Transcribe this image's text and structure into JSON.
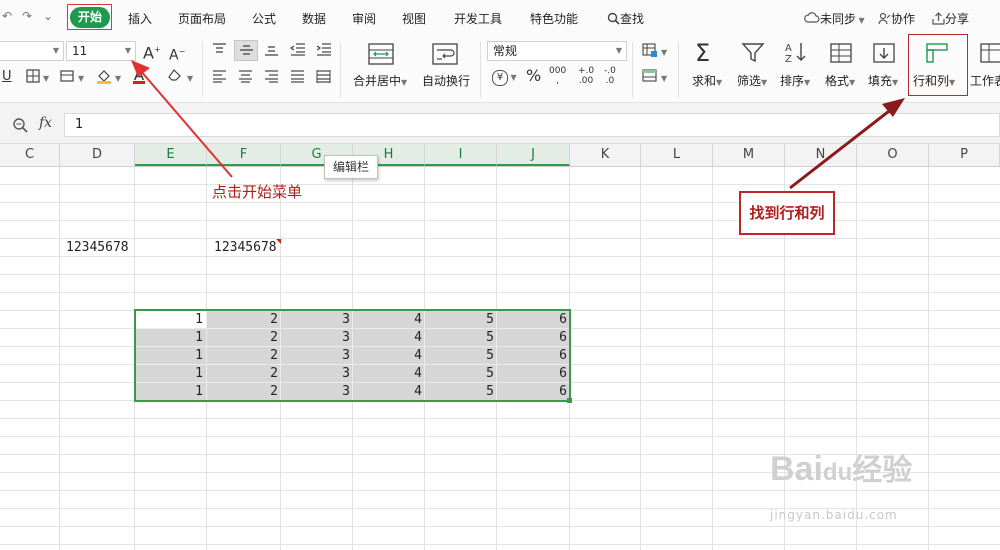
{
  "quick_access": {
    "undo": "↶",
    "redo": "↷",
    "more": "⌄"
  },
  "menu": {
    "items": [
      "开始",
      "插入",
      "页面布局",
      "公式",
      "数据",
      "审阅",
      "视图",
      "开发工具",
      "特色功能",
      "查找"
    ],
    "active": "开始",
    "right": {
      "sync": "未同步",
      "collab": "协作",
      "share": "分享"
    }
  },
  "ribbon": {
    "font_size": "11",
    "grow_font": "A",
    "shrink_font": "A",
    "merge_center": "合并居中",
    "wrap_text": "自动换行",
    "number_format": "常规",
    "currency": "¥",
    "percent": "%",
    "thousands": "000",
    "inc_decimal": "+.0",
    "dec_decimal": "-.0",
    "sum": "求和",
    "filter": "筛选",
    "sort": "排序",
    "format": "格式",
    "fill": "填充",
    "row_col": "行和列",
    "worksheet": "工作表"
  },
  "formula_bar": {
    "fx": "fx",
    "value": "1"
  },
  "columns": [
    "C",
    "D",
    "E",
    "F",
    "G",
    "H",
    "I",
    "J",
    "K",
    "L",
    "M",
    "N",
    "O",
    "P"
  ],
  "selected_columns": [
    "E",
    "F",
    "G",
    "H",
    "I",
    "J"
  ],
  "cells": {
    "d_text": "12345678",
    "f_text": "12345678"
  },
  "table": {
    "rows": [
      [
        1,
        2,
        3,
        4,
        5,
        6
      ],
      [
        1,
        2,
        3,
        4,
        5,
        6
      ],
      [
        1,
        2,
        3,
        4,
        5,
        6
      ],
      [
        1,
        2,
        3,
        4,
        5,
        6
      ],
      [
        1,
        2,
        3,
        4,
        5,
        6
      ]
    ]
  },
  "annotations": {
    "tooltip": "编辑栏",
    "click_start": "点击开始菜单",
    "find_rowcol": "找到行和列"
  },
  "watermark": {
    "brand_left": "Bai",
    "brand_right": "经验",
    "paw": "du",
    "site": "jingyan.baidu.com"
  },
  "colors": {
    "accent_green": "#1e9a4f",
    "selection_border": "#3a9a4a",
    "annotation_red": "#c02626"
  }
}
